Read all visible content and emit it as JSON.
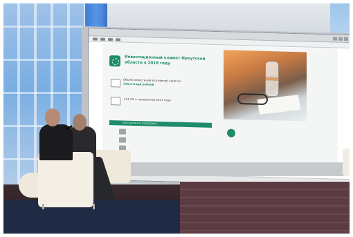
{
  "screen": {
    "window_title": "",
    "slide": {
      "title": "Инвестиционный климат Иркутской области в 2018 году",
      "stats": [
        {
          "label": "Объем инвестиций в основной капитал",
          "value": "310,4 млрд рублей"
        },
        {
          "label": "+13,2% к показателю 2017 года",
          "value": ""
        }
      ],
      "banner": "Инструменты поддержки",
      "rows": [
        "",
        "",
        ""
      ],
      "note": ""
    }
  },
  "scene": {
    "palette": {
      "slide_accent": "#1e8c6a",
      "curtain": "#2c6fd1",
      "chair": "#f4efe4",
      "stage": "#2a1d22"
    }
  }
}
